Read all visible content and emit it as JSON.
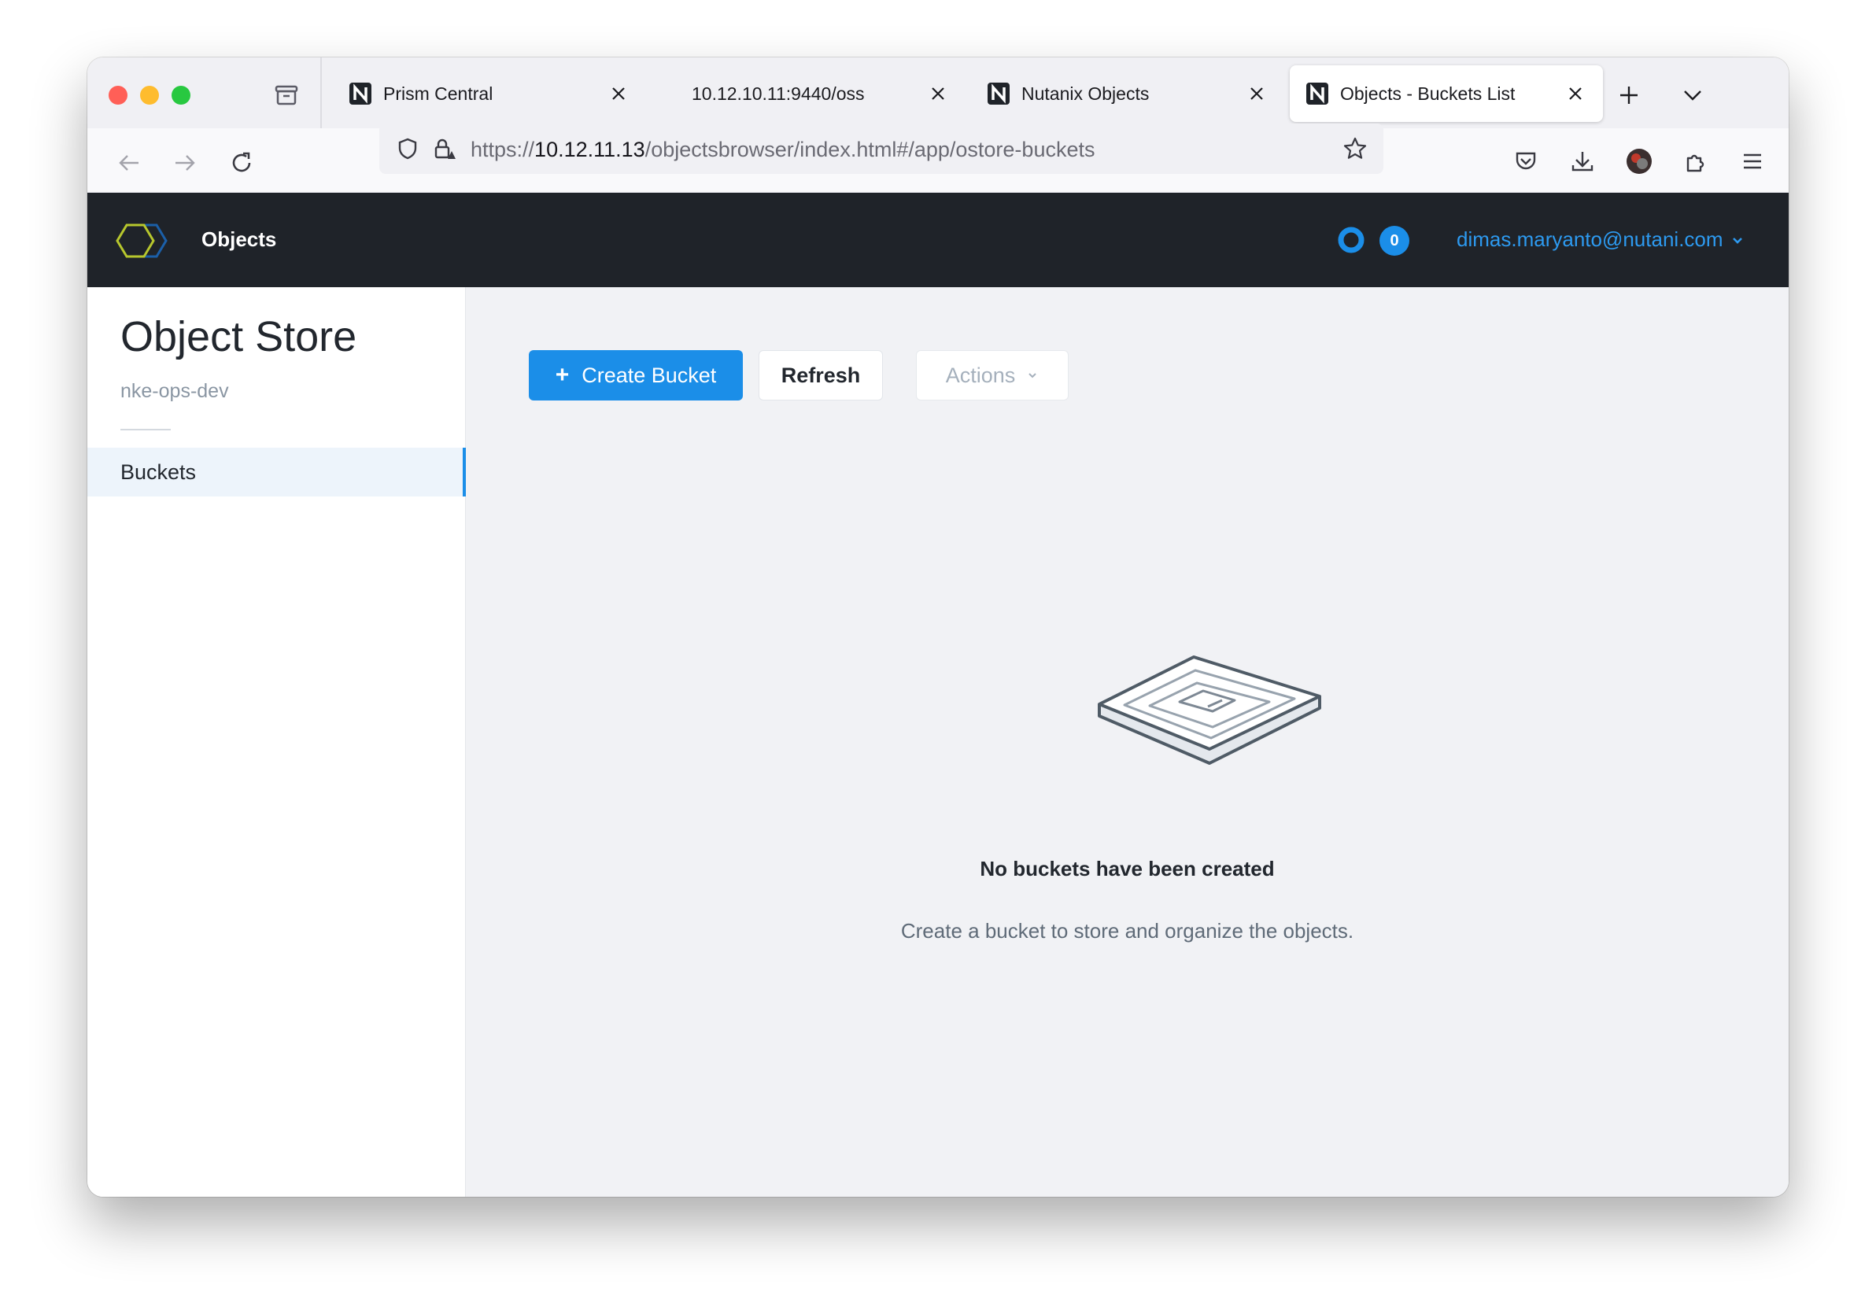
{
  "browser": {
    "tabs": [
      {
        "title": "Prism Central",
        "active": false
      },
      {
        "title": "10.12.10.11:9440/oss",
        "active": false
      },
      {
        "title": "Nutanix Objects",
        "active": false
      },
      {
        "title": "Objects - Buckets List",
        "active": true
      }
    ],
    "url": {
      "prefix": "https://",
      "host": "10.12.11.13",
      "path": "/objectsbrowser/index.html#/app/ostore-buckets"
    }
  },
  "app": {
    "name": "Objects",
    "badge_count": "0",
    "user_email": "dimas.maryanto@nutani.com"
  },
  "sidebar": {
    "title": "Object Store",
    "subtitle": "nke-ops-dev",
    "items": [
      {
        "label": "Buckets",
        "selected": true
      }
    ]
  },
  "toolbar": {
    "create_plus": "+",
    "create_label": "Create Bucket",
    "refresh_label": "Refresh",
    "actions_label": "Actions"
  },
  "empty_state": {
    "title": "No buckets have been created",
    "description": "Create a bucket to store and organize the objects."
  },
  "colors": {
    "accent": "#1b8ee8",
    "header_bg": "#1f2329",
    "link": "#2d9af0"
  }
}
